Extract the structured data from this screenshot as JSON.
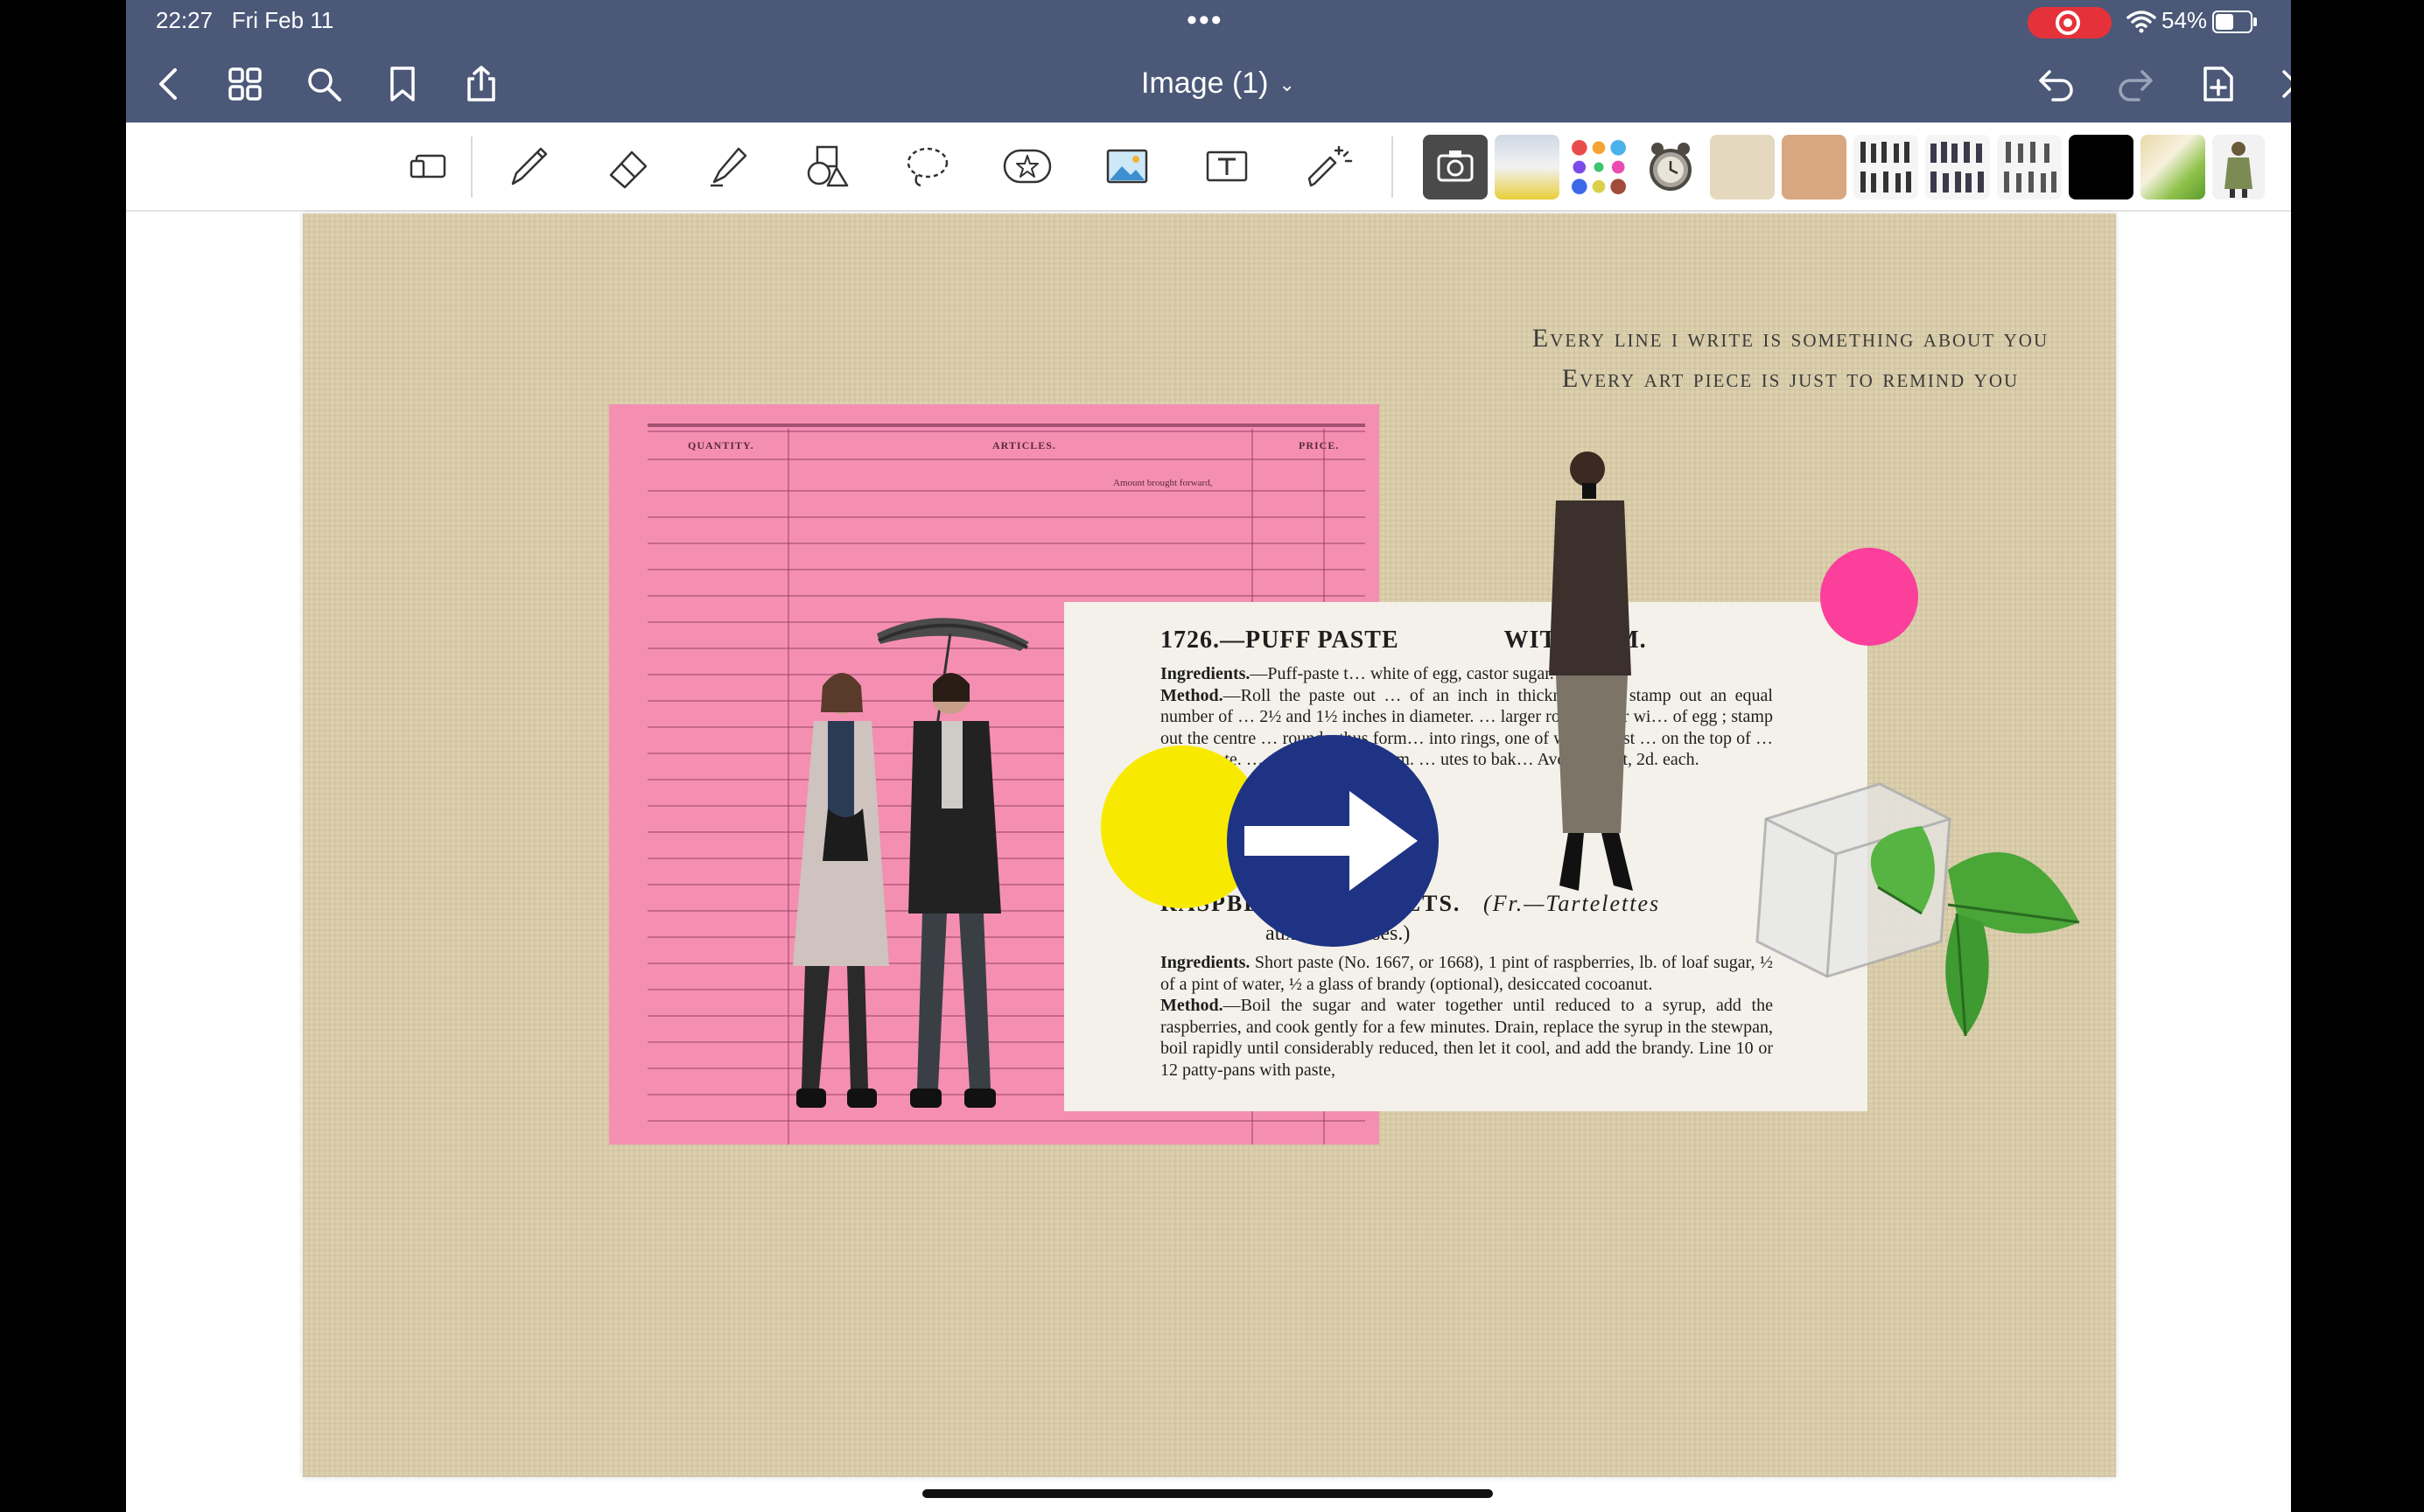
{
  "status": {
    "time": "22:27",
    "date": "Fri Feb 11",
    "battery": "54%"
  },
  "nav": {
    "title": "Image (1)"
  },
  "toolbar": {
    "tools": [
      "select-tool",
      "pen-tool",
      "eraser-tool",
      "highlighter-tool",
      "shapes-tool",
      "lasso-tool",
      "elements-tool",
      "image-tool",
      "text-tool",
      "laser-tool"
    ],
    "swatches": [
      "#454545",
      "#c9c9c9",
      "#ffffff",
      "#e8e8e8",
      "#e4d8bf",
      "#d9a77f",
      "#f2f2f2",
      "#f2f2f2",
      "#f2f2f2",
      "#000000",
      "#e9d9a9",
      "#f2f2f2"
    ]
  },
  "canvas": {
    "quote_line1": "Every line i write is something about you",
    "quote_line2": "Every art piece is just to remind you",
    "ledger": {
      "col1": "QUANTITY.",
      "col2": "ARTICLES.",
      "col3": "PRICE.",
      "note": "Amount brought forward,"
    },
    "recipe": {
      "title": "1726.—PUFF PASTE",
      "title_end": "WITH JAM.",
      "ingredients_label": "Ingredients.",
      "ingredients_text": "—Puff-paste t… white of egg, castor sugar.",
      "method_label": "Method.",
      "method_text": "—Roll the paste out … of an inch in thickness, and stamp out an equal number of … 2½ and 1½ inches in diameter. … larger rounds over wi… of egg ; stamp out the centre … rounds, thus form… into rings, one of which must … on the top of … nd of paste. … nd when cold … am. … utes to bak… Average cost, 2d. each.",
      "title2": "RASPBERRY TARTLETS.",
      "title2_fr": "(Fr.—Tartelettes",
      "title2_b": "aux Framboises.)",
      "ingredients2_label": "Ingredients.",
      "ingredients2_text": "Short paste (No. 1667, or 1668), 1 pint of raspberries, lb. of loaf sugar, ½ of a pint of water, ½ a glass of brandy (optional), desiccated cocoanut.",
      "method2_label": "Method.",
      "method2_text": "—Boil the sugar and water together until reduced to a syrup, add the raspberries, and cook gently for a few minutes. Drain, replace the syrup in the stewpan, boil rapidly until considerably reduced, then let it cool, and add the brandy. Line 10 or 12 patty-pans with paste,"
    },
    "colors": {
      "pink": "#f58fb2",
      "yellow": "#f7ea00",
      "blue": "#1f3384",
      "magenta": "#fb3f9a",
      "paper": "#ddd0ad"
    }
  }
}
